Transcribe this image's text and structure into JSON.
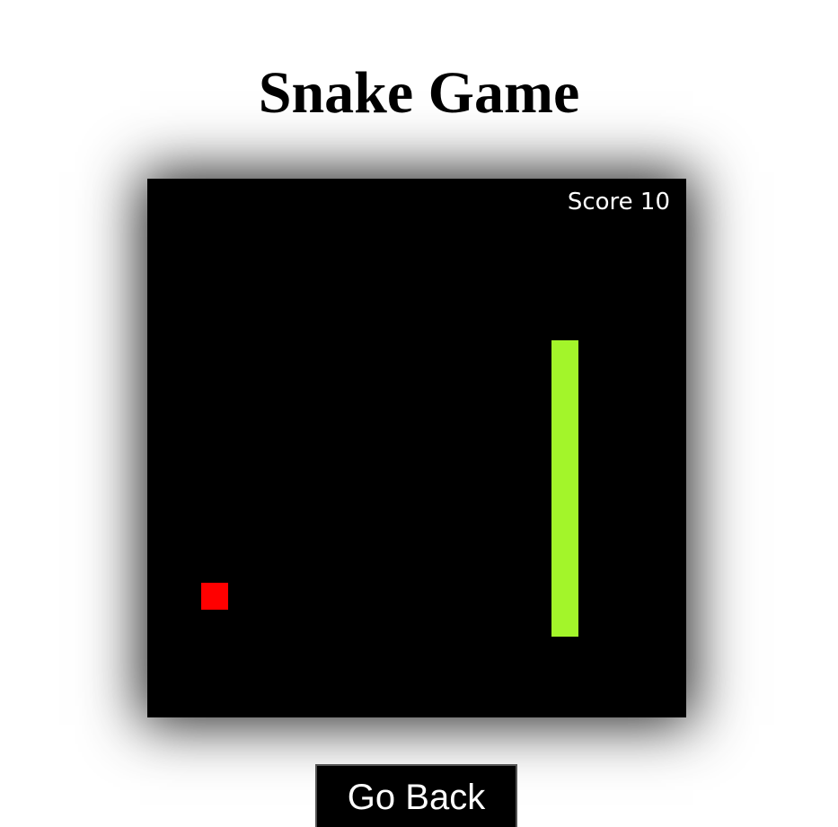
{
  "page": {
    "title": "Snake Game"
  },
  "game": {
    "score_label": "Score",
    "score": 10,
    "grid_size": 20,
    "colors": {
      "board": "#000000",
      "snake": "#a3f52a",
      "food": "#ff0000",
      "text": "#ffffff"
    },
    "snake": [
      {
        "col": 15,
        "row": 6
      },
      {
        "col": 15,
        "row": 7
      },
      {
        "col": 15,
        "row": 8
      },
      {
        "col": 15,
        "row": 9
      },
      {
        "col": 15,
        "row": 10
      },
      {
        "col": 15,
        "row": 11
      },
      {
        "col": 15,
        "row": 12
      },
      {
        "col": 15,
        "row": 13
      },
      {
        "col": 15,
        "row": 14
      },
      {
        "col": 15,
        "row": 15
      },
      {
        "col": 15,
        "row": 16
      }
    ],
    "food": {
      "col": 2,
      "row": 15
    }
  },
  "controls": {
    "go_back_label": "Go Back"
  }
}
